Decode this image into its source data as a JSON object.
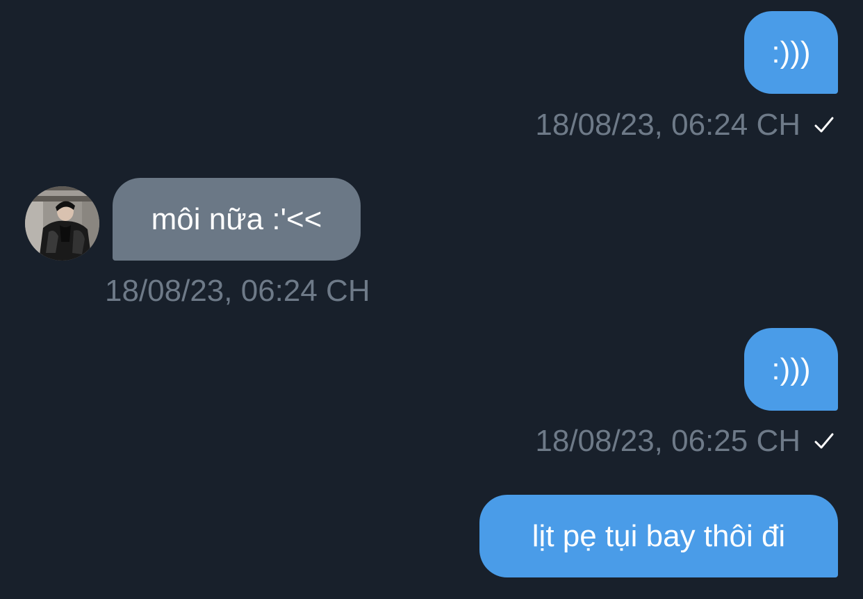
{
  "messages": [
    {
      "direction": "outgoing",
      "text": ":)))",
      "timestamp": "18/08/23, 06:24 CH",
      "status_icon": "checkmark-icon"
    },
    {
      "direction": "incoming",
      "text": "môi nữa :'<<",
      "timestamp": "18/08/23, 06:24 CH",
      "avatar_icon": "avatar"
    },
    {
      "direction": "outgoing",
      "text": ":)))",
      "timestamp": "18/08/23, 06:25 CH",
      "status_icon": "checkmark-icon"
    },
    {
      "direction": "outgoing",
      "text": "lịt pẹ tụi bay thôi đi"
    }
  ],
  "colors": {
    "background": "#18202b",
    "outgoing_bubble": "#4a9ce8",
    "incoming_bubble": "#6b7886",
    "timestamp": "#6e7a88",
    "message_text": "#ffffff"
  }
}
